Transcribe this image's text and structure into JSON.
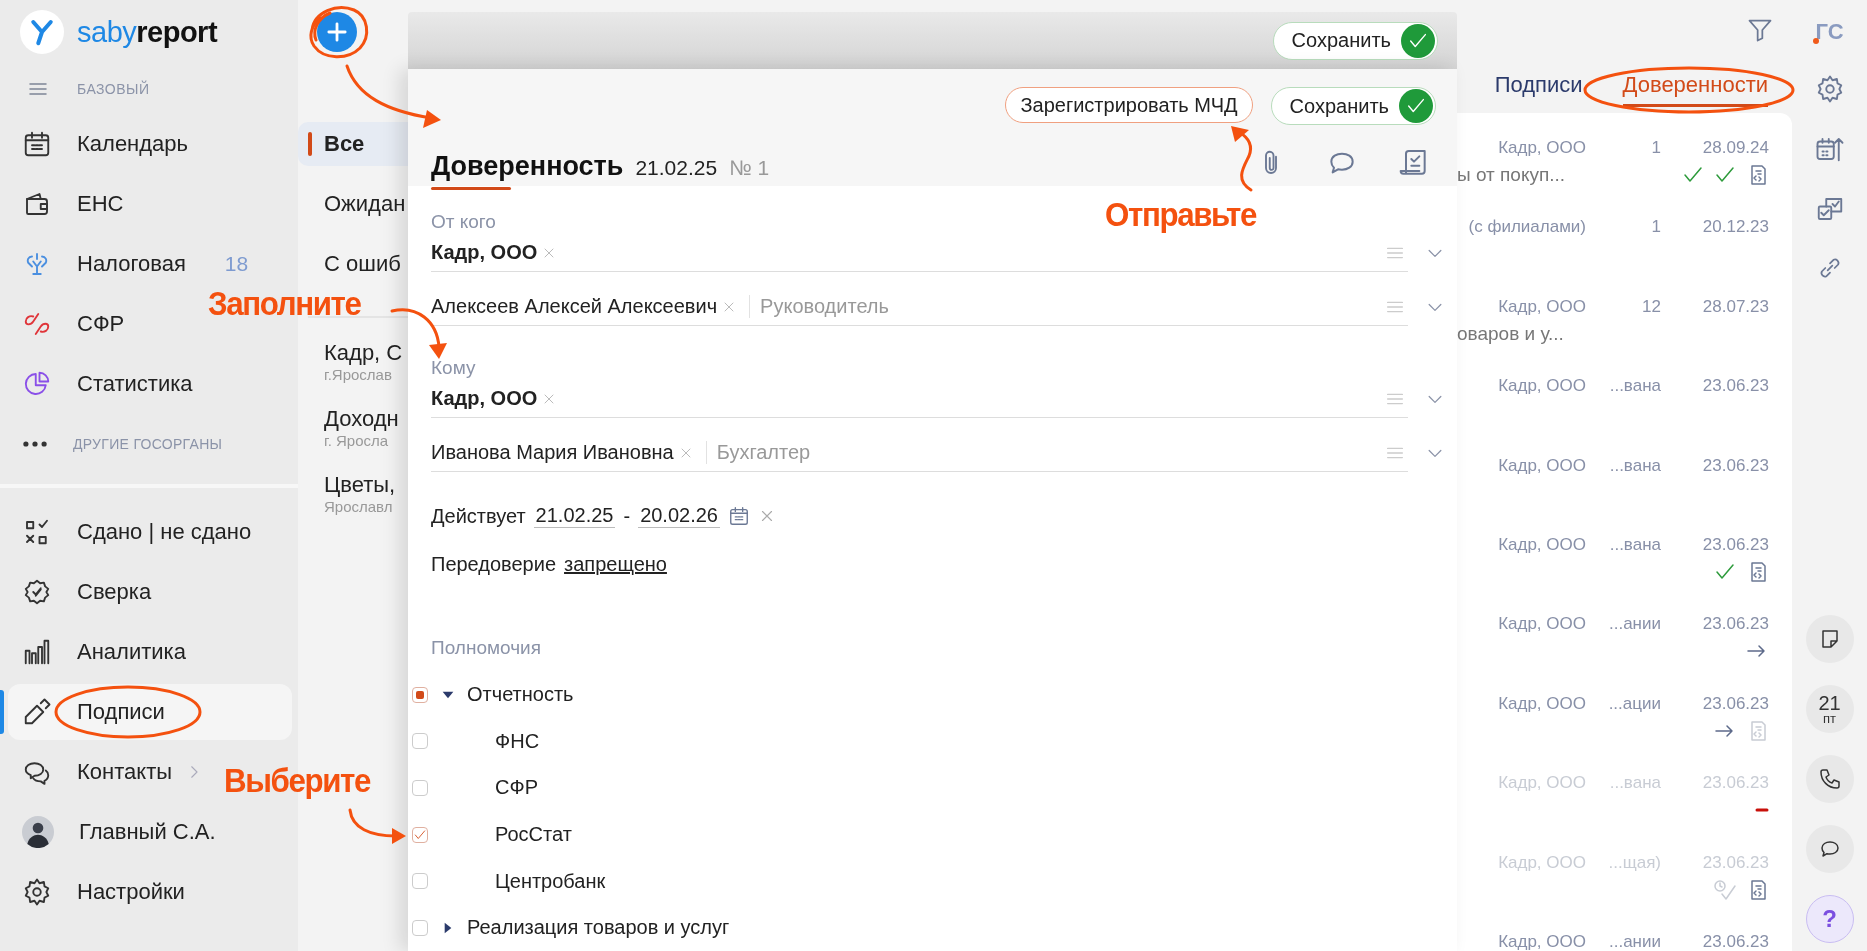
{
  "sidebar": {
    "logo": "saby**report**",
    "plan": "БАЗОВЫЙ",
    "items": [
      {
        "kind": "nav",
        "label": "Календарь",
        "selected": false
      },
      {
        "kind": "nav",
        "label": "ЕНС",
        "selected": false
      },
      {
        "kind": "nav",
        "label": "Налоговая",
        "counter": "18",
        "selected": false
      },
      {
        "kind": "nav",
        "label": "СФР",
        "selected": false
      },
      {
        "kind": "nav",
        "label": "Статистика",
        "selected": false
      },
      {
        "kind": "more",
        "label": "ДРУГИЕ ГОСОРГАНЫ"
      }
    ],
    "lower_items": [
      {
        "kind": "nav",
        "label": "Сдано | не сдано",
        "selected": false
      },
      {
        "kind": "nav",
        "label": "Сверка",
        "selected": false
      },
      {
        "kind": "nav",
        "label": "Аналитика",
        "selected": false
      },
      {
        "kind": "nav",
        "label": "Подписи",
        "selected": true
      },
      {
        "kind": "nav",
        "label": "Контакты",
        "selected": false,
        "expandable": true
      },
      {
        "kind": "user",
        "label": "Главный С.А.",
        "selected": false
      },
      {
        "kind": "nav",
        "label": "Настройки",
        "selected": false
      }
    ]
  },
  "filters": {
    "items": [
      {
        "label": "Все",
        "selected": true
      },
      {
        "label": "Ожидан",
        "selected": false
      },
      {
        "label": "С ошиб",
        "selected": false
      }
    ],
    "orgs": [
      {
        "name": "Кадр, С",
        "city": "г.Ярослав"
      },
      {
        "name": "Доходн",
        "city": "г. Яросла"
      },
      {
        "name": "Цветы,",
        "city": "Ярославл"
      }
    ]
  },
  "back_dialog": {
    "save_button": "Сохранить"
  },
  "dialog": {
    "register_button": "Зарегистрировать МЧД",
    "save_button": "Сохранить",
    "title": "Доверенность",
    "date": "21.02.25",
    "number": "№ 1",
    "from": {
      "label": "От кого",
      "org": "Кадр, ООО",
      "person": "Алексеев Алексей Алексеевич",
      "role": "Руководитель"
    },
    "to": {
      "label": "Кому",
      "org": "Кадр, ООО",
      "person": "Иванова Мария Ивановна",
      "role": "Бухгалтер"
    },
    "validity": {
      "label": "Действует",
      "from": "21.02.25",
      "separator": "-",
      "to": "20.02.26"
    },
    "redelegation": {
      "label": "Передоверие",
      "value": "запрещено"
    },
    "powers": {
      "label": "Полномочия",
      "tree": [
        {
          "label": "Отчетность",
          "checked": false,
          "partial": true,
          "expanded": true,
          "children": [
            {
              "label": "ФНС",
              "checked": false
            },
            {
              "label": "СФР",
              "checked": false
            },
            {
              "label": "РосСтат",
              "checked": true
            },
            {
              "label": "Центробанк",
              "checked": false
            }
          ]
        },
        {
          "label": "Реализация товаров и услуг",
          "checked": false,
          "partial": false,
          "expanded": false
        }
      ]
    }
  },
  "list": {
    "tabs": [
      {
        "label": "Подписи",
        "selected": false
      },
      {
        "label": "Доверенности",
        "selected": true
      }
    ],
    "rows": [
      {
        "org": "Кадр, ООО",
        "count": "1",
        "date": "28.09.24",
        "desc": "ы от покуп...",
        "icons": [
          {
            "kind": "check"
          },
          {
            "kind": "check"
          },
          {
            "kind": "doc"
          }
        ],
        "dimmed": false
      },
      {
        "org": "(с филиалами)",
        "count": "1",
        "date": "20.12.23",
        "dimmed": false
      },
      {
        "org": "Кадр, ООО",
        "count": "12",
        "date": "28.07.23",
        "desc": "оваров и у...",
        "dimmed": false
      },
      {
        "org": "Кадр, ООО",
        "count": "...вана",
        "date": "23.06.23",
        "dimmed": false
      },
      {
        "org": "Кадр, ООО",
        "count": "...вана",
        "date": "23.06.23",
        "dimmed": false
      },
      {
        "org": "Кадр, ООО",
        "count": "...вана",
        "date": "23.06.23",
        "icons": [
          {
            "kind": "check"
          },
          {
            "kind": "doc"
          }
        ],
        "dimmed": false
      },
      {
        "org": "Кадр, ООО",
        "count": "...ании",
        "date": "23.06.23",
        "icons": [
          {
            "kind": "arrow"
          }
        ],
        "dimmed": false
      },
      {
        "org": "Кадр, ООО",
        "count": "...ации",
        "date": "23.06.23",
        "icons": [
          {
            "kind": "arrow"
          },
          {
            "kind": "doc_dim"
          }
        ],
        "dimmed": false
      },
      {
        "org": "Кадр, ООО",
        "count": "...вана",
        "date": "23.06.23",
        "icons": [
          {
            "kind": "dash"
          }
        ],
        "dimmed": true
      },
      {
        "org": "Кадр, ООО",
        "count": "...щая)",
        "date": "23.06.23",
        "icons": [
          {
            "kind": "pending"
          },
          {
            "kind": "doc"
          }
        ],
        "dimmed": true
      },
      {
        "org": "Кадр, ООО",
        "count": "...ании",
        "date": "23.06.23",
        "dimmed": false
      }
    ]
  },
  "toolbar": {
    "user_initials": "ГС",
    "calendar_day": "21",
    "calendar_weekday": "пт",
    "help": "?"
  },
  "notes": [
    {
      "text": "Заполните"
    },
    {
      "text": "Отправьте"
    },
    {
      "text": "Выберите"
    }
  ]
}
